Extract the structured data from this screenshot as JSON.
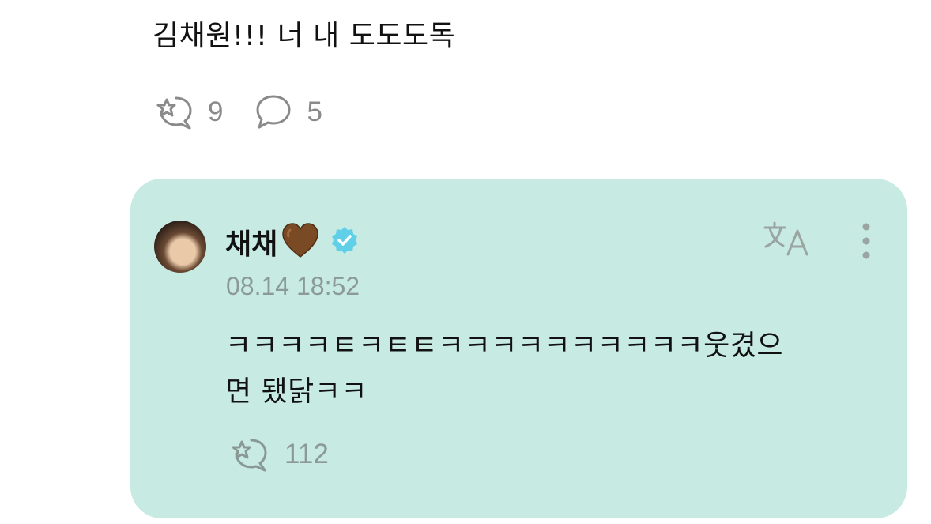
{
  "post": {
    "text": "김채원!!! 너 내 도도도독",
    "likes_count": "9",
    "comments_count": "5"
  },
  "comment": {
    "author": "채채",
    "author_emoji": "brown-heart-icon",
    "verified": true,
    "timestamp": "08.14 18:52",
    "text_line1": "ㅋㅋㅋㅋㅌㅋㅌㅌㅋㅋㅋㅋㅋㅋㅋㅋㅋㅋ웃겼으",
    "text_line2": "면 됐닭ㅋㅋ",
    "likes_count": "112"
  },
  "colors": {
    "card_background": "#c7eae3",
    "muted_text": "#8a8a8a",
    "verified_badge": "#5fd0e8",
    "heart": "#7a4a24"
  },
  "icons": {
    "like": "star-chat-bubble-icon",
    "comment": "chat-bubble-icon",
    "translate": "translate-icon",
    "more": "more-vertical-icon"
  }
}
